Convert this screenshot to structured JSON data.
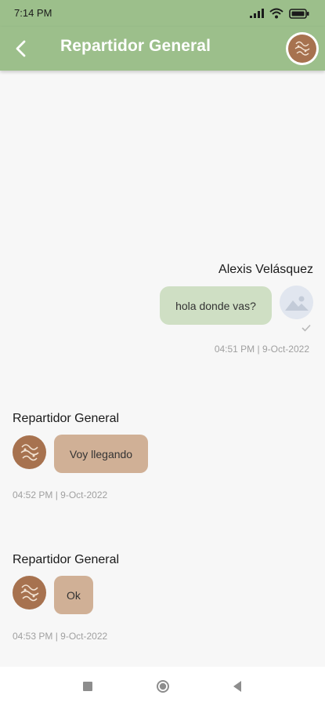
{
  "status_bar": {
    "time": "7:14 PM"
  },
  "header": {
    "title": "Repartidor General"
  },
  "messages": [
    {
      "sender": "Alexis Velásquez",
      "text": "hola donde vas?",
      "timestamp": "04:51 PM | 9-Oct-2022",
      "direction": "outgoing"
    },
    {
      "sender": "Repartidor General",
      "text": "Voy llegando",
      "timestamp": "04:52 PM | 9-Oct-2022",
      "direction": "incoming"
    },
    {
      "sender": "Repartidor General",
      "text": "Ok",
      "timestamp": "04:53 PM | 9-Oct-2022",
      "direction": "incoming"
    }
  ],
  "icons": {
    "back": "back-arrow-icon",
    "outgoing_avatar": "image-placeholder-icon",
    "delivered": "check-icon",
    "signal": "signal-icon",
    "wifi": "wifi-icon",
    "battery": "battery-icon",
    "nav_recents": "square-icon",
    "nav_home": "circle-icon",
    "nav_back": "triangle-icon"
  },
  "colors": {
    "header": "#9cbf8b",
    "outgoing_bubble": "#cfdfc4",
    "incoming_bubble": "#d0b096",
    "avatar": "#a7724f",
    "background": "#f7f7f7"
  }
}
